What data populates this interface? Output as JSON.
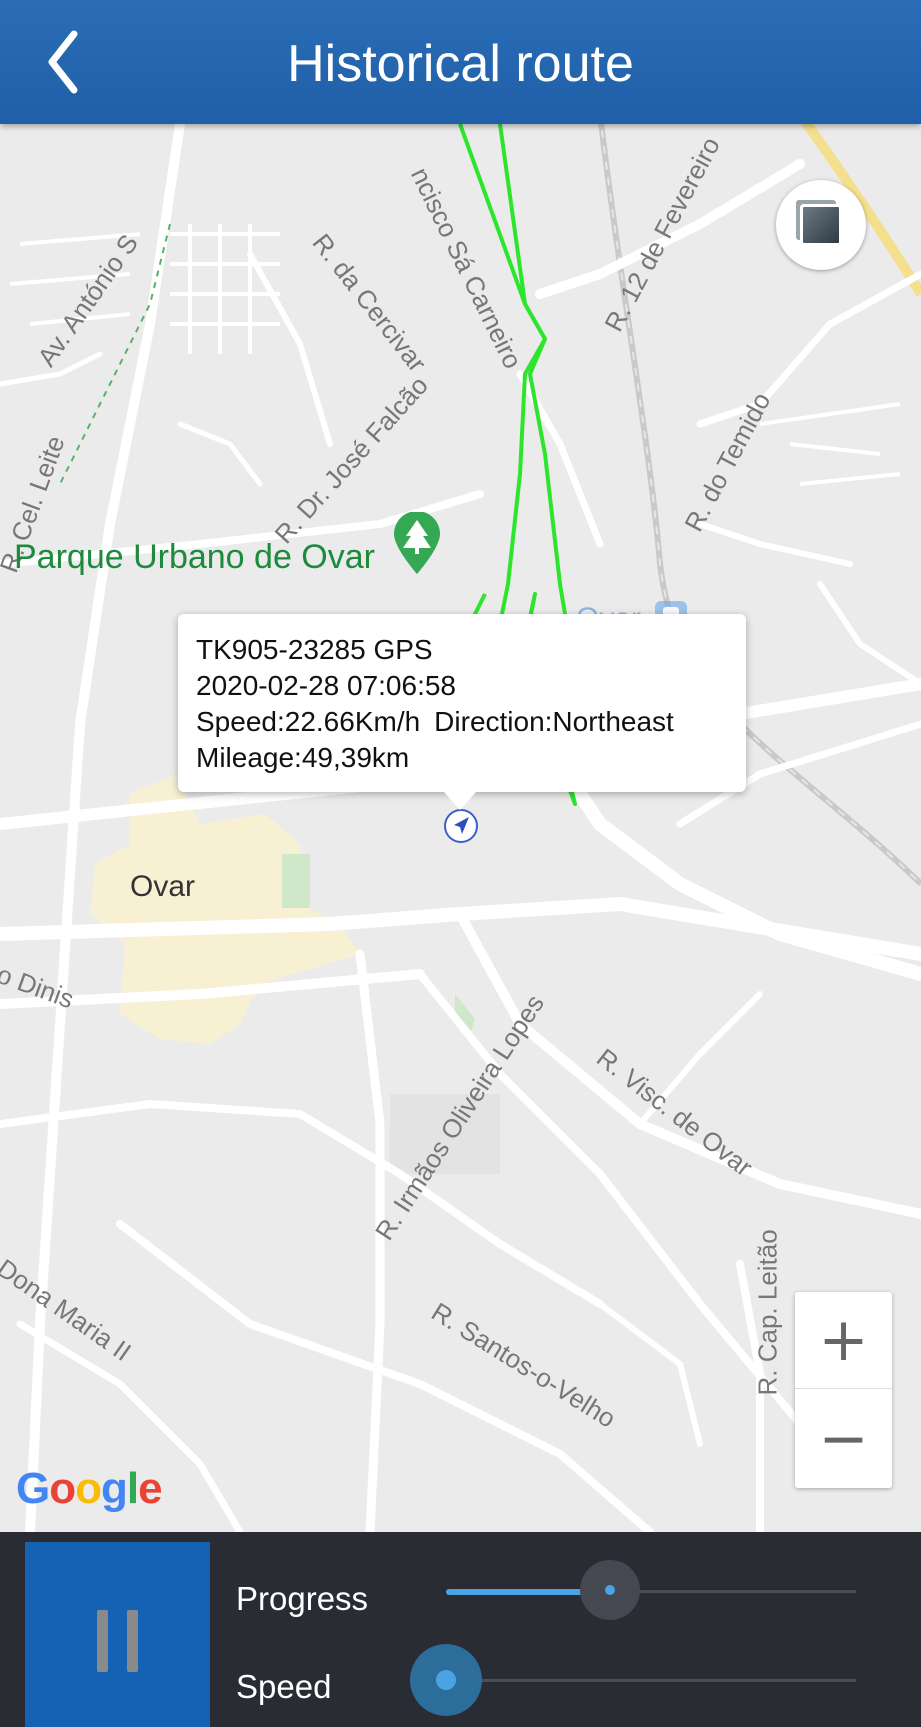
{
  "header": {
    "title": "Historical route",
    "back_icon": "chevron-left-icon",
    "background_color": "#2266b0"
  },
  "map": {
    "street_labels": {
      "av_antonio": "Av. António S",
      "r_da_cercivar": "R. da Cercivar",
      "r_francisco": "ncisco Sá Carneiro",
      "r_12_fevereiro": "R. 12 de Fevereiro",
      "r_jose_falcao": "R. Dr. José Falcão",
      "r_do_temido": "R. do Temido",
      "r_cel_leite": "R. Cel. Leite",
      "r_irmaos": "R. Irmãos Oliveira Lopes",
      "r_visc_ovar": "R. Visc. de Ovar",
      "r_santos": "R. Santos-o-Velho",
      "r_cap_leitao": "R. Cap. Leitão",
      "dona_maria": "Dona Maria II",
      "o_dinis": "o Dinis"
    },
    "poi_label": "Parque Urbano de Ovar",
    "poi_icon": "park-tree-icon",
    "station_label": "Ovar",
    "station_icon": "train-station-icon",
    "town_label": "Ovar",
    "route_color": "#2ee52e",
    "marker_icon": "navigation-arrow-icon",
    "layer_icon": "map-layers-icon",
    "info_window": {
      "device": "TK905-23285 GPS",
      "datetime": "2020-02-28 07:06:58",
      "speed": "Speed:22.66Km/h",
      "direction": "Direction:Northeast",
      "mileage": "Mileage:49,39km"
    },
    "zoom_in": "+",
    "zoom_out": "−",
    "attribution": "Google"
  },
  "controls": {
    "play_pause_icon": "pause-icon",
    "progress_label": "Progress",
    "speed_label": "Speed",
    "progress_value": 0.4,
    "speed_value": 0.0,
    "accent_color": "#4aa4e4",
    "button_color": "#1562b5"
  }
}
